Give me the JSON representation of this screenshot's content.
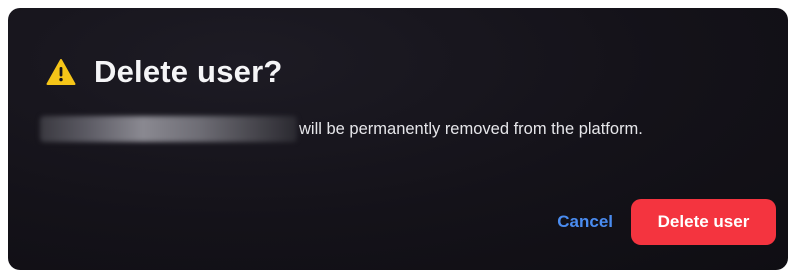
{
  "dialog": {
    "icon": "warning-icon",
    "title": "Delete user?",
    "message": "will be permanently removed from the platform.",
    "cancel_label": "Cancel",
    "confirm_label": "Delete user"
  },
  "colors": {
    "background": "#141219",
    "warning": "#f5c518",
    "cancel_link": "#4a8cf0",
    "danger": "#f4343f"
  }
}
